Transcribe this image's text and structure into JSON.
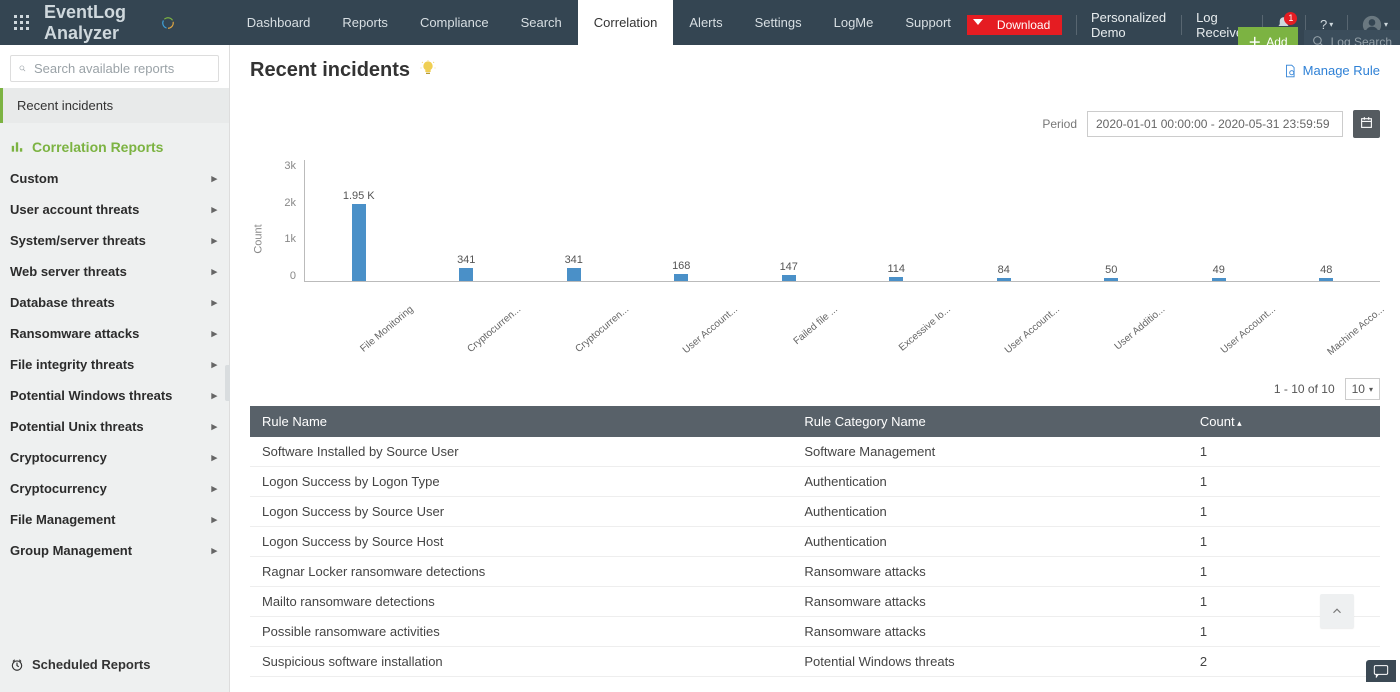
{
  "colors": {
    "accent": "#7cb342",
    "primary": "#344552",
    "barFill": "#4a90c8",
    "redBtn": "#e51c22"
  },
  "header": {
    "appName": "EventLog Analyzer",
    "nav": [
      "Dashboard",
      "Reports",
      "Compliance",
      "Search",
      "Correlation",
      "Alerts",
      "Settings",
      "LogMe",
      "Support"
    ],
    "activeNav": "Correlation",
    "downloadLabel": "Download",
    "trLinks": [
      "Personalized Demo",
      "Log Receiver"
    ],
    "alertsBadge": "1",
    "addLabel": "Add",
    "logSearchPlaceholder": "Log Search"
  },
  "sidebar": {
    "searchPlaceholder": "Search available reports",
    "recentLabel": "Recent incidents",
    "heading": "Correlation Reports",
    "items": [
      "Custom",
      "User account threats",
      "System/server threats",
      "Web server threats",
      "Database threats",
      "Ransomware attacks",
      "File integrity threats",
      "Potential Windows threats",
      "Potential Unix threats",
      "Cryptocurrency",
      "Cryptocurrency",
      "File Management",
      "Group Management"
    ],
    "footerLabel": "Scheduled Reports"
  },
  "main": {
    "title": "Recent incidents",
    "manageLabel": "Manage Rule",
    "periodLabel": "Period",
    "periodValue": "2020-01-01 00:00:00 - 2020-05-31 23:59:59",
    "pager": "1 - 10 of 10",
    "pageSize": "10"
  },
  "table": {
    "headers": [
      "Rule Name",
      "Rule Category Name",
      "Count"
    ],
    "rows": [
      {
        "name": "Software Installed by Source User",
        "cat": "Software Management",
        "count": "1"
      },
      {
        "name": "Logon Success by Logon Type",
        "cat": "Authentication",
        "count": "1"
      },
      {
        "name": "Logon Success by Source User",
        "cat": "Authentication",
        "count": "1"
      },
      {
        "name": "Logon Success by Source Host",
        "cat": "Authentication",
        "count": "1"
      },
      {
        "name": "Ragnar Locker ransomware detections",
        "cat": "Ransomware attacks",
        "count": "1"
      },
      {
        "name": "Mailto ransomware detections",
        "cat": "Ransomware attacks",
        "count": "1"
      },
      {
        "name": "Possible ransomware activities",
        "cat": "Ransomware attacks",
        "count": "1"
      },
      {
        "name": "Suspicious software installation",
        "cat": "Potential Windows threats",
        "count": "2"
      }
    ]
  },
  "chart_data": {
    "type": "bar",
    "ylabel": "Count",
    "ylim": [
      0,
      3000
    ],
    "yticks": [
      "3k",
      "2k",
      "1k",
      "0"
    ],
    "categories": [
      "File Monitoring",
      "Cryptocurren...",
      "Cryptocurren...",
      "User Account...",
      "Failed file ...",
      "Excessive lo...",
      "User Account...",
      "User Additio...",
      "User Account...",
      "Machine Acco..."
    ],
    "values": [
      1950,
      341,
      341,
      168,
      147,
      114,
      84,
      50,
      49,
      48
    ],
    "dataLabels": [
      "1.95 K",
      "341",
      "341",
      "168",
      "147",
      "114",
      "84",
      "50",
      "49",
      "48"
    ]
  }
}
